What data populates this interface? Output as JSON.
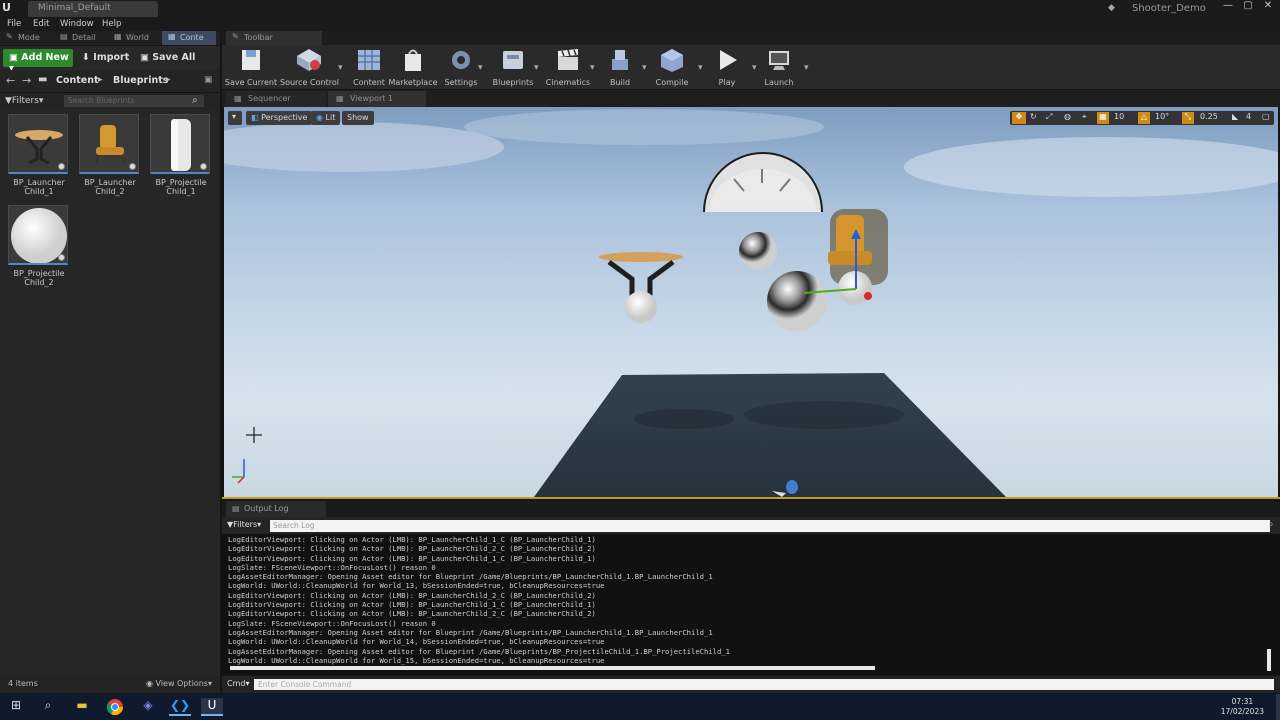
{
  "window": {
    "document_tab": "Minimal_Default",
    "project_name": "Shooter_Demo",
    "controls": {
      "minimize": "—",
      "maximize": "▢",
      "close": "✕"
    }
  },
  "menu": [
    "File",
    "Edit",
    "Window",
    "Help"
  ],
  "left_tabs": [
    "Mode",
    "Detail",
    "World",
    "Conte"
  ],
  "content_browser": {
    "add_new": "Add New",
    "import": "Import",
    "save_all": "Save All",
    "path": [
      "Content",
      "Blueprints"
    ],
    "filters": "Filters",
    "search_placeholder": "Search Blueprints",
    "assets": [
      {
        "line1": "BP_Launcher",
        "line2": "Child_1"
      },
      {
        "line1": "BP_Launcher",
        "line2": "Child_2"
      },
      {
        "line1": "BP_Projectile",
        "line2": "Child_1"
      },
      {
        "line1": "BP_Projectile",
        "line2": "Child_2"
      }
    ],
    "item_count": "4 items",
    "view_options": "View Options"
  },
  "toolbar": {
    "tab": "Toolbar",
    "buttons": [
      "Save Current",
      "Source Control",
      "Content",
      "Marketplace",
      "Settings",
      "Blueprints",
      "Cinematics",
      "Build",
      "Compile",
      "Play",
      "Launch"
    ]
  },
  "viewport_tabs": [
    "Sequencer",
    "Viewport 1"
  ],
  "viewport": {
    "perspective": "Perspective",
    "lit": "Lit",
    "show": "Show",
    "grid_snap": "10",
    "rotation_snap": "10°",
    "scale_snap": "0.25",
    "camera_speed": "4"
  },
  "output_log": {
    "tab": "Output Log",
    "filters": "Filters",
    "search_placeholder": "Search Log",
    "lines": [
      "LogEditorViewport: Clicking on Actor (LMB): BP_LauncherChild_1_C (BP_LauncherChild_1)",
      "LogEditorViewport: Clicking on Actor (LMB): BP_LauncherChild_2_C (BP_LauncherChild_2)",
      "LogEditorViewport: Clicking on Actor (LMB): BP_LauncherChild_1_C (BP_LauncherChild_1)",
      "LogSlate: FSceneViewport::OnFocusLost() reason 0",
      "LogAssetEditorManager: Opening Asset editor for Blueprint /Game/Blueprints/BP_LauncherChild_1.BP_LauncherChild_1",
      "LogWorld: UWorld::CleanupWorld for World_13, bSessionEnded=true, bCleanupResources=true",
      "LogEditorViewport: Clicking on Actor (LMB): BP_LauncherChild_2_C (BP_LauncherChild_2)",
      "LogEditorViewport: Clicking on Actor (LMB): BP_LauncherChild_1_C (BP_LauncherChild_1)",
      "LogEditorViewport: Clicking on Actor (LMB): BP_LauncherChild_2_C (BP_LauncherChild_2)",
      "LogSlate: FSceneViewport::OnFocusLost() reason 0",
      "LogAssetEditorManager: Opening Asset editor for Blueprint /Game/Blueprints/BP_LauncherChild_1.BP_LauncherChild_1",
      "LogWorld: UWorld::CleanupWorld for World_14, bSessionEnded=true, bCleanupResources=true",
      "LogAssetEditorManager: Opening Asset editor for Blueprint /Game/Blueprints/BP_ProjectileChild_1.BP_ProjectileChild_1",
      "LogWorld: UWorld::CleanupWorld for World_15, bSessionEnded=true, bCleanupResources=true"
    ],
    "cmd_label": "Cmd",
    "cmd_placeholder": "Enter Console Command"
  },
  "taskbar": {
    "time": "07:31",
    "date": "17/02/2023"
  },
  "colors": {
    "accent_green": "#2d8a2d",
    "tab_active": "#3c4a63",
    "viewport_border": "#c89a20",
    "snap_active": "#d08a1a"
  }
}
